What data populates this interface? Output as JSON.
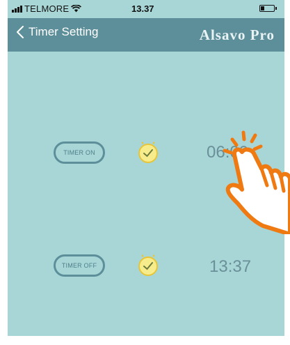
{
  "status_bar": {
    "carrier": "TELMORE",
    "time": "13.37"
  },
  "nav": {
    "back_label": "Timer Setting",
    "brand": "Alsavo Pro"
  },
  "timers": [
    {
      "button_label": "TIMER ON",
      "time": "06:00"
    },
    {
      "button_label": "TIMER OFF",
      "time": "13:37"
    }
  ],
  "colors": {
    "background": "#a8d6d6",
    "nav_bar": "#5d8f9a",
    "clock_icon": "#f3e26a",
    "tap_hand_outline": "#f07a12"
  },
  "icons": {
    "back": "chevron-left-icon",
    "clock": "clock-check-icon",
    "tap_hint": "tap-hand-icon",
    "wifi": "wifi-icon",
    "battery": "battery-icon",
    "signal": "signal-icon"
  }
}
